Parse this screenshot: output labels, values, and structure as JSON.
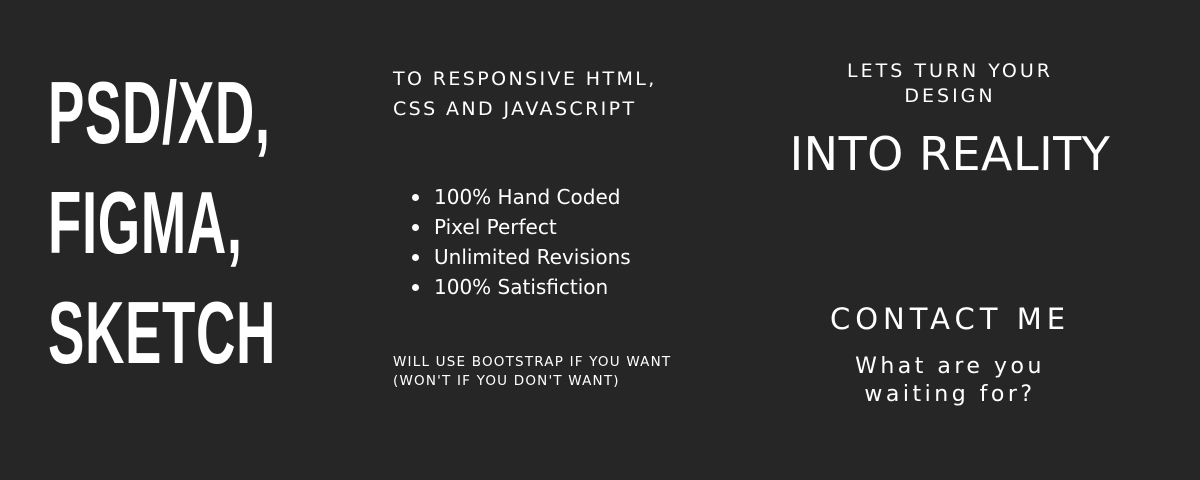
{
  "headline": {
    "lines": [
      "PSD/XD,",
      "FIGMA,",
      "SKETCH"
    ]
  },
  "subtitle": {
    "line1": "TO RESPONSIVE HTML,",
    "line2": "CSS AND JAVASCRIPT"
  },
  "features": {
    "items": [
      "100% Hand Coded",
      "Pixel Perfect",
      "Unlimited Revisions",
      "100% Satisfiction"
    ]
  },
  "note": {
    "line1": "WILL USE BOOTSTRAP IF YOU WANT",
    "line2": "(WON'T IF YOU DON'T WANT)"
  },
  "right": {
    "tagline_line1": "LETS TURN YOUR",
    "tagline_line2": "DESIGN",
    "reality": "INTO REALITY",
    "contact": "CONTACT ME",
    "waiting_line1": "What are you",
    "waiting_line2": "waiting for?"
  },
  "colors": {
    "background": "#262626",
    "text": "#ffffff"
  }
}
